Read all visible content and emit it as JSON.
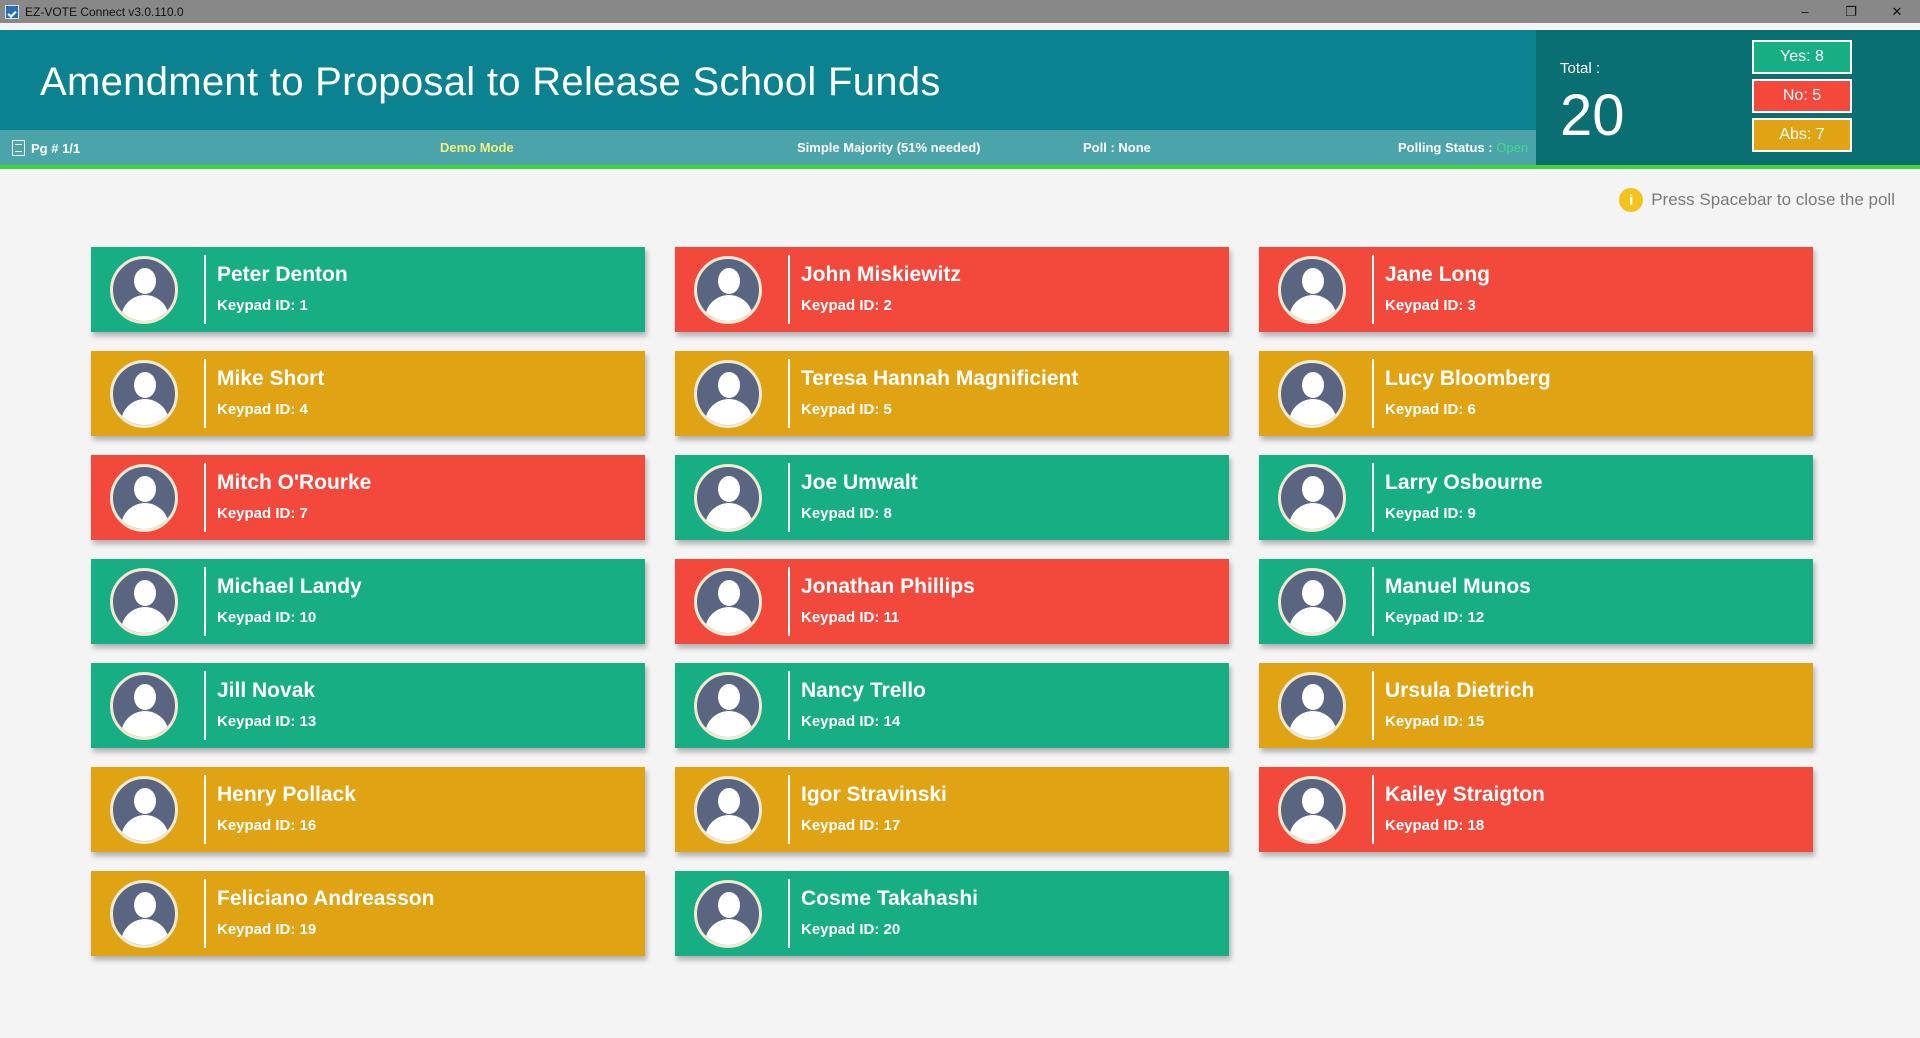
{
  "window": {
    "title": "EZ-VOTE Connect v3.0.110.0",
    "minimize_glyph": "–",
    "restore_glyph": "❐",
    "close_glyph": "✕"
  },
  "header": {
    "poll_title": "Amendment to Proposal to Release School Funds",
    "page": "Pg # 1/1",
    "mode": "Demo Mode",
    "majority": "Simple Majority (51% needed)",
    "poll_label": "Poll :",
    "poll_value": "None",
    "status_label": "Polling Status :",
    "status_value": "Open"
  },
  "totals": {
    "total_label": "Total :",
    "total_value": "20",
    "yes": "Yes: 8",
    "no": "No: 5",
    "abs": "Abs: 7"
  },
  "hint": {
    "icon": "info-icon",
    "text": "Press Spacebar to close the poll"
  },
  "colors": {
    "yes": "#17ae83",
    "no": "#f2493c",
    "abs": "#e0a314",
    "header": "#0b8290"
  },
  "voters": [
    {
      "name": "Peter Denton",
      "keypad": "Keypad ID: 1",
      "vote": "yes"
    },
    {
      "name": "John Miskiewitz",
      "keypad": "Keypad ID: 2",
      "vote": "no"
    },
    {
      "name": "Jane Long",
      "keypad": "Keypad ID: 3",
      "vote": "no"
    },
    {
      "name": "Mike Short",
      "keypad": "Keypad ID: 4",
      "vote": "abs"
    },
    {
      "name": "Teresa Hannah Magnificient",
      "keypad": "Keypad ID: 5",
      "vote": "abs"
    },
    {
      "name": "Lucy Bloomberg",
      "keypad": "Keypad ID: 6",
      "vote": "abs"
    },
    {
      "name": "Mitch O'Rourke",
      "keypad": "Keypad ID: 7",
      "vote": "no"
    },
    {
      "name": "Joe Umwalt",
      "keypad": "Keypad ID: 8",
      "vote": "yes"
    },
    {
      "name": "Larry Osbourne",
      "keypad": "Keypad ID: 9",
      "vote": "yes"
    },
    {
      "name": "Michael Landy",
      "keypad": "Keypad ID: 10",
      "vote": "yes"
    },
    {
      "name": "Jonathan Phillips",
      "keypad": "Keypad ID: 11",
      "vote": "no"
    },
    {
      "name": "Manuel Munos",
      "keypad": "Keypad ID: 12",
      "vote": "yes"
    },
    {
      "name": "Jill Novak",
      "keypad": "Keypad ID: 13",
      "vote": "yes"
    },
    {
      "name": "Nancy Trello",
      "keypad": "Keypad ID: 14",
      "vote": "yes"
    },
    {
      "name": "Ursula Dietrich",
      "keypad": "Keypad ID: 15",
      "vote": "abs"
    },
    {
      "name": "Henry Pollack",
      "keypad": "Keypad ID: 16",
      "vote": "abs"
    },
    {
      "name": "Igor Stravinski",
      "keypad": "Keypad ID: 17",
      "vote": "abs"
    },
    {
      "name": "Kailey Straigton",
      "keypad": "Keypad ID: 18",
      "vote": "no"
    },
    {
      "name": "Feliciano Andreasson",
      "keypad": "Keypad ID: 19",
      "vote": "abs"
    },
    {
      "name": "Cosme Takahashi",
      "keypad": "Keypad ID: 20",
      "vote": "yes"
    }
  ]
}
